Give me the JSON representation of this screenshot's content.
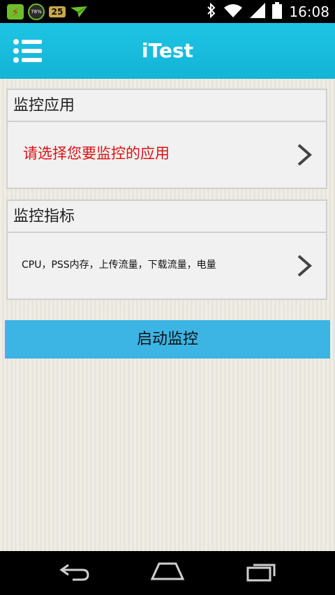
{
  "status_bar": {
    "time": "16:08",
    "badge_number": "25",
    "gauge_text": "78%",
    "icons": [
      "app-store-icon",
      "gauge-icon",
      "badge-icon",
      "send-icon",
      "bluetooth-icon",
      "wifi-icon",
      "signal-icon",
      "battery-icon"
    ]
  },
  "app_bar": {
    "title": "iTest",
    "menu_icon": "menu-list-icon"
  },
  "monitor_app": {
    "header": "监控应用",
    "prompt": "请选择您要监控的应用"
  },
  "monitor_metrics": {
    "header": "监控指标",
    "value": "CPU，PSS内存，上传流量，下载流量，电量"
  },
  "start_button": {
    "label": "启动监控"
  },
  "nav_bar": {
    "icons": [
      "back-icon",
      "home-icon",
      "recents-icon"
    ]
  },
  "colors": {
    "app_bar": "#1fc4e5",
    "prompt_text": "#dd1111",
    "start_button": "#3cb5e4",
    "background": "#ece9e1"
  }
}
